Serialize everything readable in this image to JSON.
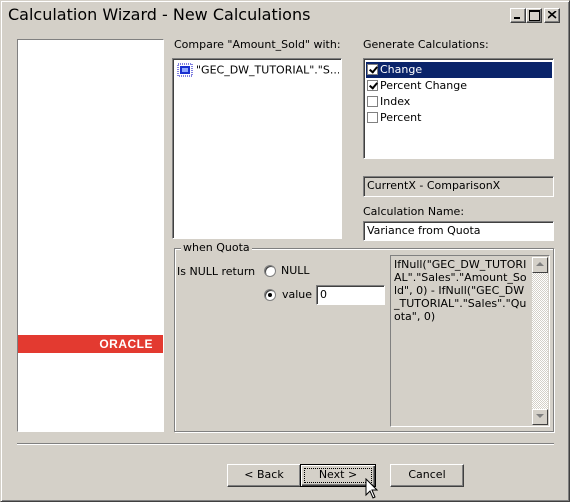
{
  "window": {
    "title": "Calculation Wizard - New Calculations"
  },
  "branding": {
    "logo_text": "ORACLE",
    "logo_color": "#e33a30"
  },
  "compare": {
    "label": "Compare \"Amount_Sold\" with:",
    "items": [
      {
        "text": "\"GEC_DW_TUTORIAL\".\"S...",
        "icon": "measure-icon"
      }
    ]
  },
  "generate": {
    "label": "Generate Calculations:",
    "items": [
      {
        "label": "Change",
        "checked": true,
        "selected": true
      },
      {
        "label": "Percent Change",
        "checked": true,
        "selected": false
      },
      {
        "label": "Index",
        "checked": false,
        "selected": false
      },
      {
        "label": "Percent",
        "checked": false,
        "selected": false
      }
    ]
  },
  "expression_preview": "CurrentX - ComparisonX",
  "calc_name": {
    "label": "Calculation Name:",
    "value": "Variance from Quota"
  },
  "quota_group": {
    "title": "when Quota",
    "is_null_label": "Is NULL return",
    "null_option": "NULL",
    "value_option": "value",
    "selected_option": "value",
    "value": "0"
  },
  "formula": "IfNull(\"GEC_DW_TUTORIAL\".\"Sales\".\"Amount_Sold\", 0) - IfNull(\"GEC_DW_TUTORIAL\".\"Sales\".\"Quota\", 0)",
  "buttons": {
    "back": "< Back",
    "next": "Next >",
    "cancel": "Cancel"
  },
  "colors": {
    "selection": "#0a246a",
    "face": "#d4d0c8"
  }
}
